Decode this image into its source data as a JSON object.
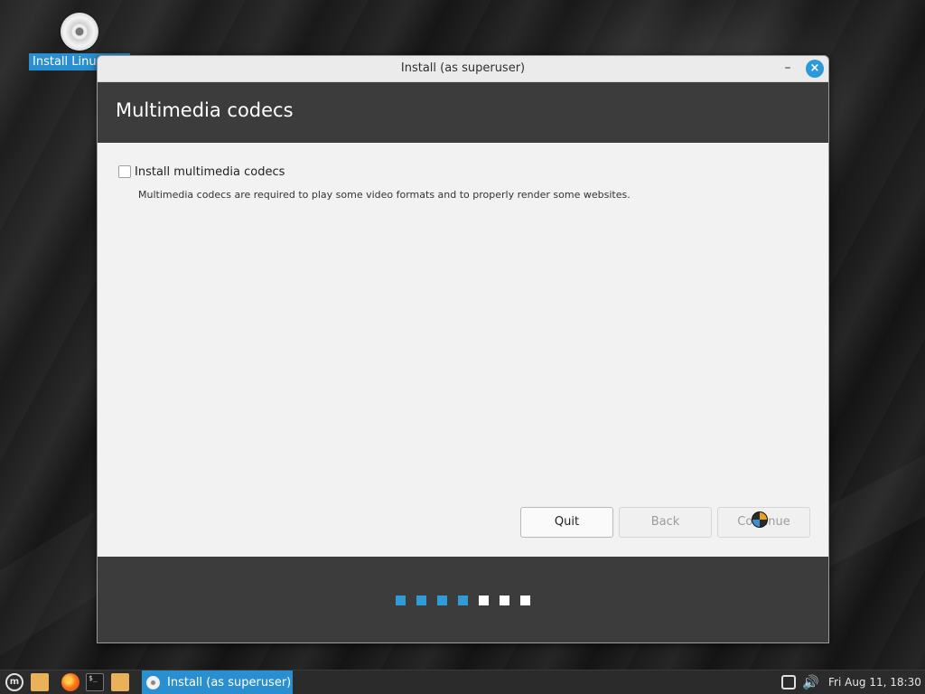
{
  "desktop": {
    "icon_label": "Install Linux"
  },
  "window": {
    "title": "Install (as superuser)",
    "minimize_glyph": "–",
    "close_glyph": "×",
    "page_title": "Multimedia codecs",
    "option_label": "Install multimedia codecs",
    "option_checked": false,
    "option_description": "Multimedia codecs are required to play some video formats and to properly render some websites.",
    "buttons": {
      "quit": "Quit",
      "back": "Back",
      "continue": "Continue"
    },
    "progress": {
      "completed_steps": 4,
      "total_steps": 7
    }
  },
  "taskbar": {
    "menu_glyph": "m",
    "terminal_glyph": "$_",
    "task_label": "Install (as superuser)",
    "volume_glyph": "🔊",
    "clock": "Fri Aug 11, 18:30"
  },
  "colors": {
    "accent": "#2a8fd0",
    "header": "#3c3c3c"
  }
}
